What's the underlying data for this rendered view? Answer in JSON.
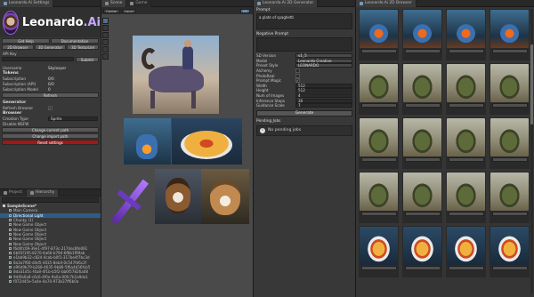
{
  "settings": {
    "tab": "Leonardo.Ai Settings",
    "logo_text": "Leonardo",
    "logo_suffix": ".Ai",
    "row1": [
      "Get Help",
      "Documentation"
    ],
    "row2": [
      "2D Browser",
      "3D Generator",
      "3D Texturizer"
    ],
    "api_key_label": "API Key",
    "submit": "Submit",
    "username_label": "Username",
    "username_value": "Skylosper",
    "tokens_label": "Tokens",
    "tokens": [
      {
        "k": "Subscription",
        "v": "0/0"
      },
      {
        "k": "Subscription (API)",
        "v": "0/0"
      },
      {
        "k": "Subscription Model",
        "v": "0"
      }
    ],
    "refresh": "Refresh",
    "generator_label": "Generator",
    "refresh_browser": "Refresh Browser",
    "browser_label": "Browser",
    "creation_type_label": "Creation Type",
    "creation_type_value": "Sprite",
    "disable_nsfw": "Disable NSFW",
    "change_current": "Change current path",
    "change_import": "Change import path",
    "reset": "Reset settings"
  },
  "hierarchy": {
    "tabs": [
      "Project",
      "Hierarchy"
    ],
    "scene": "SampleScene*",
    "items": [
      "Main Camera",
      "Directional Light",
      "Chunky (1)",
      "New Game Object",
      "New Game Object",
      "New Game Object",
      "New Game Object",
      "New Game Object",
      "f6d0fc09-39e1-4f97-873c-2174ec8fe061",
      "6b91f195-8270-4a66-b794-6f8b1f99ab",
      "e1bb9b32-c824-4cab-b0f1-317be4f7bc3d",
      "8a3a7f66-d4d5-4035-8eb4-0c547fd6c2f",
      "e96d9b79-b268-4635-9b86-5f6a4b56fcb5",
      "8da31d5c-f4a8-4f1b-b5f2-bb6f57826a08",
      "9d4fa0a8-c6c6-4f0e-9a0a-00fc7b1a9da1",
      "f072d45e-5a4e-4a70-973b37ff6b0a"
    ]
  },
  "scene": {
    "tabs": [
      "Scene",
      "Game"
    ],
    "toolbar": [
      "Center",
      "Local",
      "2D"
    ]
  },
  "generator": {
    "tab": "Leonardo.Ai 2D Generator",
    "prompt_label": "Prompt",
    "prompt_value": "a plate of spaghetti",
    "negative_label": "Negative Prompt",
    "params": [
      {
        "k": "SD Version",
        "v": "v1_5"
      },
      {
        "k": "Model",
        "v": "Leonardo Creative"
      },
      {
        "k": "Preset Style",
        "v": "LEONARDO"
      },
      {
        "k": "Alchemy",
        "v": ""
      },
      {
        "k": "PhotoReal",
        "v": ""
      },
      {
        "k": "Prompt Magic",
        "v": "✓"
      },
      {
        "k": "Width",
        "v": "512"
      },
      {
        "k": "Height",
        "v": "512"
      },
      {
        "k": "Num of Images",
        "v": "4"
      },
      {
        "k": "Inference Steps",
        "v": "30"
      },
      {
        "k": "Guidance Scale",
        "v": "7"
      }
    ],
    "generate": "Generate",
    "pending_label": "Pending Jobs",
    "pending_msg": "No pending jobs"
  },
  "browser": {
    "tab": "Leonardo.Ai 2D Browser",
    "thumb_rows": [
      "potion",
      "tank",
      "tank",
      "tank",
      "spaghetti"
    ]
  },
  "colors": {
    "reset_button": "#a01818",
    "accent": "#4d6e9a",
    "logo_suffix": "#c6a8ff"
  }
}
